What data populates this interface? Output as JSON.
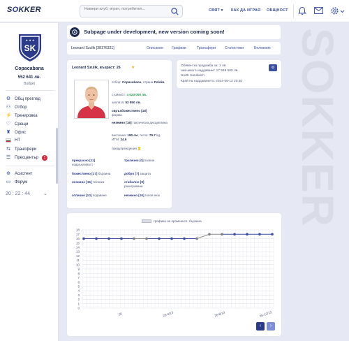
{
  "header": {
    "logo_left": "S",
    "logo_o": "O",
    "logo_rest": "KKER",
    "search_placeholder": "Намери клуб, играч, потребител...",
    "nav": [
      {
        "label": "СВЯТ ▾"
      },
      {
        "label": "КАК ДА ИГРАЯ"
      },
      {
        "label": "ОБЩНОСТ"
      }
    ],
    "icons": [
      "bell-icon",
      "mail-icon",
      "gear-icon"
    ]
  },
  "sidebar": {
    "crest_letters": "SK",
    "club_name": "Copacabana",
    "budget": "552 641 лв.",
    "budget_label": "Budget",
    "items": [
      {
        "label": "Общ преглед",
        "icon": "overview-icon"
      },
      {
        "label": "Отбор",
        "icon": "team-icon"
      },
      {
        "label": "Тренировка",
        "icon": "training-icon"
      },
      {
        "label": "Срещи",
        "icon": "matches-icon"
      },
      {
        "label": "Офис",
        "icon": "office-icon"
      },
      {
        "label": "НТ",
        "icon": "flag-icon"
      },
      {
        "label": "Трансфери",
        "icon": "transfers-icon"
      },
      {
        "label": "Пресцентър",
        "icon": "press-icon",
        "badge": "1"
      },
      {
        "label": "Асистент",
        "icon": "assistant-icon"
      },
      {
        "label": "Форум",
        "icon": "forum-icon"
      }
    ],
    "time_partial": "20 : 22 : 44"
  },
  "notice": {
    "text": "Subpage under development, new version coming soon!"
  },
  "tabs": {
    "player": "Leonard Szulik [38176321]",
    "links": [
      "Описание",
      "Графики",
      "Трансфери",
      "Статистики",
      "Бележник"
    ]
  },
  "player": {
    "title": "Leonard Szulik, възраст: 26",
    "team_label": "отбор:",
    "team": "Copacabana",
    "country_label": ", страна",
    "country": "Polska",
    "value_label": "стойност:",
    "value": "4 023 000 лв.",
    "salary_label": "заплата:",
    "salary": "52 850 лв.",
    "form_value": "свръхбожествено [18]",
    "form_label": "форма",
    "tactical_value": "неземно [16]",
    "tactical_label": "тактическа дисциплина",
    "height_label": "височина:",
    "height": "180 см",
    "weight_label": ", тегло:",
    "weight": "79.7",
    "bmi_label": "kg, ИТМ:",
    "bmi": "24.6",
    "warnings": "предупреждения:",
    "skills": [
      {
        "value": "прекрасно [11]",
        "label": "издръжливост"
      },
      {
        "value": "трагично [0]",
        "label": "пазене"
      },
      {
        "value": "божествено [17]",
        "label": "бързина"
      },
      {
        "value": "добро [7]",
        "label": "защита"
      },
      {
        "value": "неземно [16]",
        "label": "техника"
      },
      {
        "value": "стабилно [8]",
        "label": "разиграване"
      },
      {
        "value": "отлично [10]",
        "label": "подаване"
      },
      {
        "value": "неземно [16]",
        "label": "голов нюх"
      }
    ]
  },
  "transfer": {
    "line1": "Обявен за продажба за: 1 лв.",
    "line2": "най-много наддаване: 17 559 500 лв.",
    "line3": "North Sandwich",
    "line4": "Край на наддаването: 2024-06-12 20:40"
  },
  "watermark": "SOKKER",
  "chart_data": {
    "type": "line",
    "legend": "графика на промените: бързина",
    "y_ticks": [
      0,
      1,
      2,
      3,
      4,
      5,
      6,
      7,
      8,
      9,
      10,
      11,
      12,
      13,
      14,
      15,
      16,
      17,
      18
    ],
    "ylim": [
      0,
      18
    ],
    "x_labels": [
      "26",
      "26-4/13",
      "26-8/13",
      "26-12/13"
    ],
    "series": [
      {
        "values": [
          16,
          16,
          16,
          16,
          16,
          16,
          16,
          16,
          16,
          16,
          17,
          17,
          17,
          17,
          17,
          17
        ]
      }
    ],
    "point_colors": [
      "#3a4fa0",
      "#3a4fa0",
      "#3a4fa0",
      "#3a4fa0",
      "#7f7f7f",
      "#7f7f7f",
      "#3a4fa0",
      "#3a4fa0",
      "#3a4fa0",
      "#7f7f7f",
      "#7f7f7f",
      "#7f7f7f",
      "#3a4fa0",
      "#3a4fa0",
      "#3a4fa0",
      "#3a4fa0"
    ],
    "grid": true,
    "line_color_past": "#8a8a8a",
    "line_color": "#3a4fa0"
  },
  "pager": {
    "prev": "‹",
    "next": "›"
  }
}
